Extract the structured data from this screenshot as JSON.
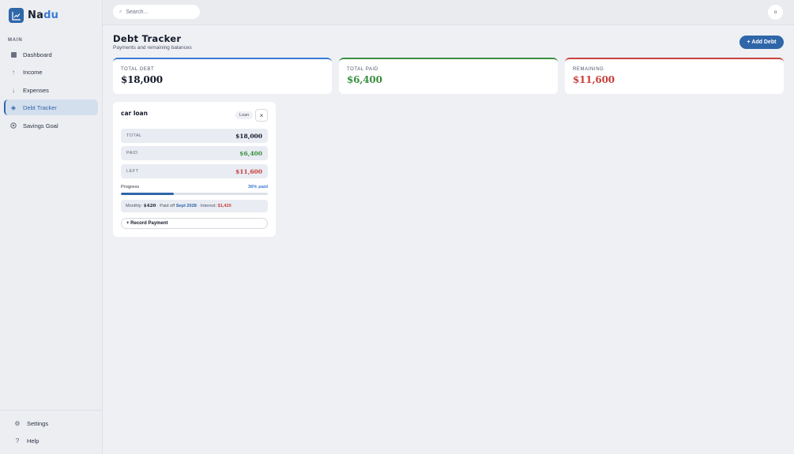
{
  "brand": {
    "name_main": "Na",
    "name_accent": "du"
  },
  "sidebar": {
    "section_label": "MAIN",
    "items": [
      {
        "label": "Dashboard",
        "icon": "grid-icon"
      },
      {
        "label": "Income",
        "icon": "arrow-up-icon"
      },
      {
        "label": "Expenses",
        "icon": "arrow-down-icon"
      },
      {
        "label": "Debt Tracker",
        "icon": "diamond-icon",
        "active": true
      },
      {
        "label": "Savings Goal",
        "icon": "circle-icon"
      }
    ],
    "footer": [
      {
        "label": "Settings",
        "icon": "gear-icon"
      },
      {
        "label": "Help",
        "icon": "question-icon"
      }
    ]
  },
  "topbar": {
    "search_placeholder": "Search...",
    "avatar": "o"
  },
  "header": {
    "title": "Debt Tracker",
    "subtitle": "Payments and remaining balances",
    "add_label": "+ Add Debt"
  },
  "stats": [
    {
      "label": "TOTAL DEBT",
      "value": "$18,000",
      "color": "#3a7bd5",
      "value_color": "#14192a"
    },
    {
      "label": "TOTAL PAID",
      "value": "$6,400",
      "color": "#3a8f3f",
      "value_color": "#3a8f3f"
    },
    {
      "label": "REMAINING",
      "value": "$11,600",
      "color": "#c8413c",
      "value_color": "#c8413c"
    }
  ],
  "debt": {
    "name": "car loan",
    "badge": "Loan",
    "close": "×",
    "rows": [
      {
        "label": "TOTAL",
        "value": "$18,000",
        "color": "#14192a"
      },
      {
        "label": "PAID",
        "value": "$6,400",
        "color": "#3a8f3f"
      },
      {
        "label": "LEFT",
        "value": "$11,600",
        "color": "#c8413c"
      }
    ],
    "progress_label": "Progress",
    "progress_text": "36% paid",
    "progress_fraction": 0.36,
    "meta": {
      "monthly_label": "Monthly:",
      "monthly_value": "$420",
      "paid_off_label": "· Paid off",
      "paid_off_value": "Sept 2028",
      "interest_label": "· Interest:",
      "interest_value": "$1,420"
    },
    "record_label": "+ Record Payment"
  },
  "colors": {
    "accent": "#2f66a8",
    "green": "#3a8f3f",
    "red": "#c8413c"
  }
}
